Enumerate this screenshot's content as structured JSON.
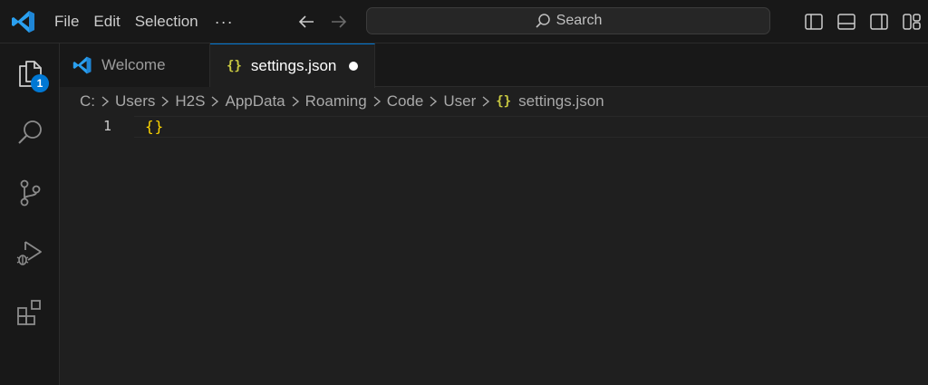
{
  "menu": {
    "file": "File",
    "edit": "Edit",
    "selection": "Selection",
    "more": "···"
  },
  "search": {
    "label": "Search"
  },
  "activity": {
    "explorer_badge": "1"
  },
  "tabs": [
    {
      "label": "Welcome",
      "icon": "vscode-logo-icon",
      "active": false
    },
    {
      "label": "settings.json",
      "icon": "json-braces-icon",
      "active": true,
      "dirty": true
    }
  ],
  "json_icon_glyph": "{}",
  "breadcrumb": {
    "items": [
      "C:",
      "Users",
      "H2S",
      "AppData",
      "Roaming",
      "Code",
      "User"
    ],
    "file": "settings.json"
  },
  "editor": {
    "lines": [
      {
        "number": "1",
        "text": "{}"
      }
    ]
  },
  "colors": {
    "accent": "#0078d4",
    "json_icon": "#cbcb41",
    "bracket": "#ffd700",
    "background": "#1f1f1f"
  }
}
